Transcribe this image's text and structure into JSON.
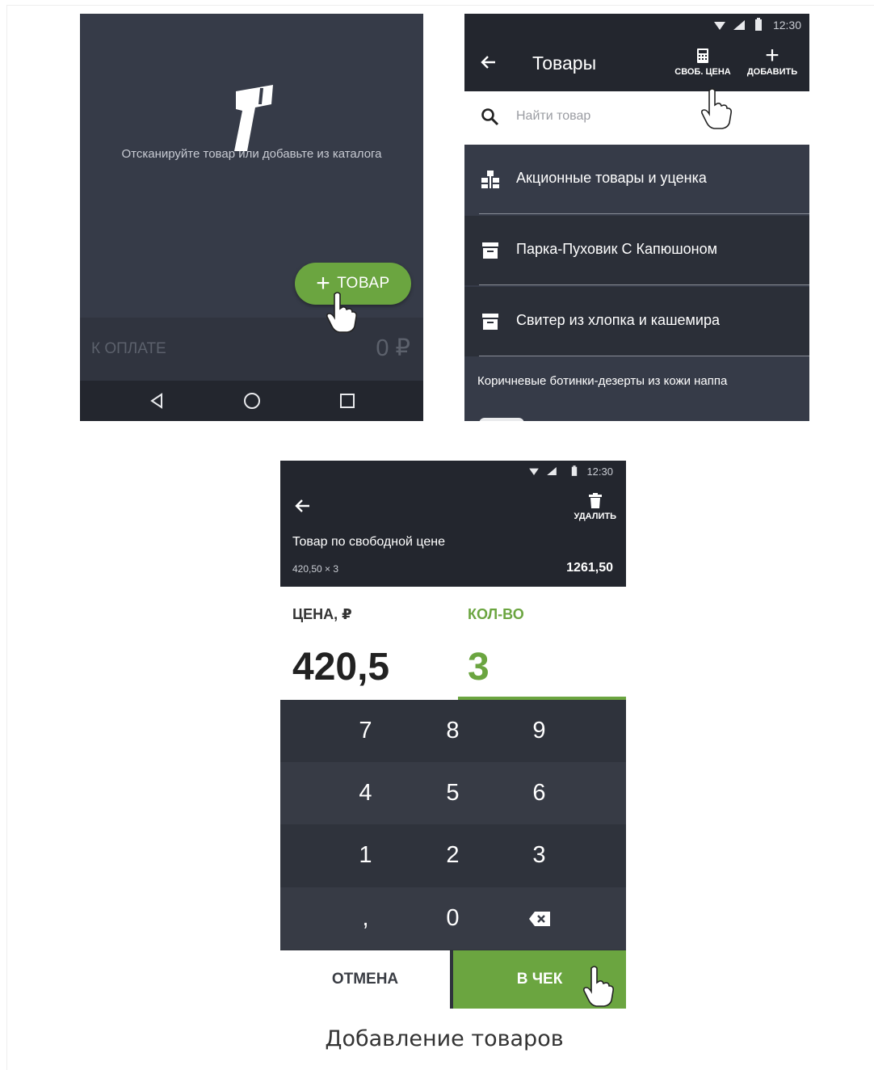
{
  "screen_scan": {
    "hint": "Отсканируйте товар или добавьте из каталога",
    "fab_label": "ТОВАР",
    "pay_label": "К ОПЛАТЕ",
    "pay_amount": "0 ₽"
  },
  "screen_catalog": {
    "status_time": "12:30",
    "title": "Товары",
    "action_free_price": "СВОБ. ЦЕНА",
    "action_add": "ДОБАВИТЬ",
    "search_placeholder": "Найти товар",
    "items": [
      {
        "label": "Акционные товары и уценка",
        "icon": "category-icon"
      },
      {
        "label": "Парка-Пуховик С Капюшоном",
        "icon": "product-icon"
      },
      {
        "label": "Свитер из хлопка и кашемира",
        "icon": "product-icon"
      }
    ],
    "last_item": "Коричневые ботинки-дезерты из кожи наппа"
  },
  "screen_price": {
    "status_time": "12:30",
    "delete_label": "УДАЛИТЬ",
    "item_name": "Товар по свободной цене",
    "calc": "420,50 × 3",
    "total": "1261,50",
    "price_label": "ЦЕНА, ₽",
    "price_value": "420,5",
    "qty_label": "КОЛ-ВО",
    "qty_value": "3",
    "keypad": [
      [
        "7",
        "8",
        "9"
      ],
      [
        "4",
        "5",
        "6"
      ],
      [
        "1",
        "2",
        "3"
      ],
      [
        ",",
        "0",
        ""
      ]
    ],
    "cancel_label": "ОТМЕНА",
    "confirm_label": "В ЧЕК"
  },
  "caption": "Добавление товаров",
  "colors": {
    "accent": "#6ba540",
    "dark": "#363b48",
    "bar": "#23262e"
  }
}
